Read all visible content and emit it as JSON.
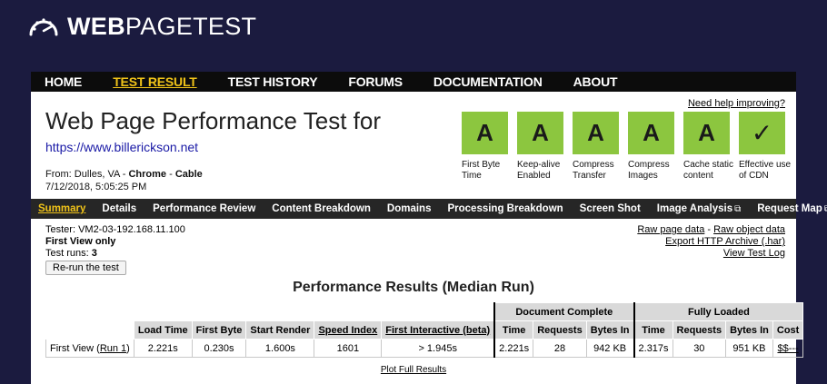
{
  "brand": {
    "bold": "WEB",
    "rest": "PAGETEST"
  },
  "nav": {
    "items": [
      "HOME",
      "TEST RESULT",
      "TEST HISTORY",
      "FORUMS",
      "DOCUMENTATION",
      "ABOUT"
    ]
  },
  "header": {
    "need_help": "Need help improving?",
    "title": "Web Page Performance Test for",
    "url": "https://www.billerickson.net",
    "from_prefix": "From: Dulles, VA - ",
    "browser": "Chrome",
    "sep": " - ",
    "connection": "Cable",
    "date": "7/12/2018, 5:05:25 PM"
  },
  "grades": [
    {
      "value": "A",
      "label": "First Byte Time"
    },
    {
      "value": "A",
      "label": "Keep-alive Enabled"
    },
    {
      "value": "A",
      "label": "Compress Transfer"
    },
    {
      "value": "A",
      "label": "Compress Images"
    },
    {
      "value": "A",
      "label": "Cache static content"
    },
    {
      "value": "✓",
      "label": "Effective use of CDN"
    }
  ],
  "subnav": {
    "items": [
      "Summary",
      "Details",
      "Performance Review",
      "Content Breakdown",
      "Domains",
      "Processing Breakdown",
      "Screen Shot",
      "Image Analysis",
      "Request Map"
    ]
  },
  "info": {
    "tester": "Tester: VM2-03-192.168.11.100",
    "view": "First View only",
    "runs_label": "Test runs: ",
    "runs_value": "3",
    "rerun": "Re-run the test"
  },
  "links": {
    "raw_page": "Raw page data",
    "dash": " - ",
    "raw_object": "Raw object data",
    "export": "Export HTTP Archive (.har)",
    "log": "View Test Log"
  },
  "results": {
    "title": "Performance Results (Median Run)",
    "group_doc": "Document Complete",
    "group_full": "Fully Loaded",
    "headers": [
      "Load Time",
      "First Byte",
      "Start Render",
      "Speed Index",
      "First Interactive (beta)",
      "Time",
      "Requests",
      "Bytes In",
      "Time",
      "Requests",
      "Bytes In",
      "Cost"
    ],
    "row": {
      "label": "First View (",
      "run_link": "Run 1",
      "label_end": ")",
      "cells": [
        "2.221s",
        "0.230s",
        "1.600s",
        "1601",
        "> 1.945s",
        "2.221s",
        "28",
        "942 KB",
        "2.317s",
        "30",
        "951 KB",
        "$$---"
      ]
    },
    "plot": "Plot Full Results"
  }
}
